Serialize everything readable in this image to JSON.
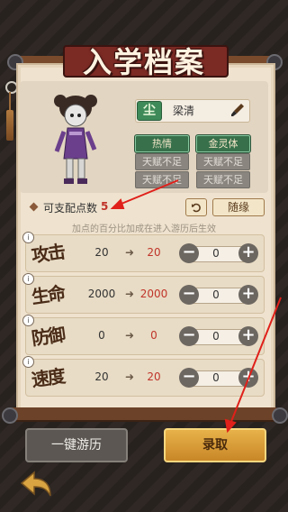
{
  "title": "入学档案",
  "character": {
    "dust_label": "尘",
    "name": "梁清",
    "traits": [
      {
        "label": "热情",
        "state": "on"
      },
      {
        "label": "金灵体",
        "state": "on"
      },
      {
        "label": "天赋不足",
        "state": "off"
      },
      {
        "label": "天赋不足",
        "state": "off"
      },
      {
        "label": "天赋不足",
        "state": "off"
      },
      {
        "label": "天赋不足",
        "state": "off"
      }
    ]
  },
  "points": {
    "label": "可支配点数",
    "value": "5",
    "undo_icon": "undo-icon",
    "random_label": "随缘"
  },
  "hint": "加点的百分比加成在进入游历后生效",
  "stats": [
    {
      "name": "攻击",
      "base": "20",
      "final": "20",
      "alloc": "0"
    },
    {
      "name": "生命",
      "base": "2000",
      "final": "2000",
      "alloc": "0"
    },
    {
      "name": "防御",
      "base": "0",
      "final": "0",
      "alloc": "0"
    },
    {
      "name": "速度",
      "base": "20",
      "final": "20",
      "alloc": "0"
    }
  ],
  "stat_arrow": "➜",
  "stat_info": "i",
  "minus_symbol": "−",
  "plus_symbol": "+",
  "buttons": {
    "one_click": "一键游历",
    "enroll": "录取"
  },
  "colors": {
    "accent_red": "#c0342a",
    "trait_green": "#37704b",
    "enroll_gold": "#e8b24a"
  }
}
